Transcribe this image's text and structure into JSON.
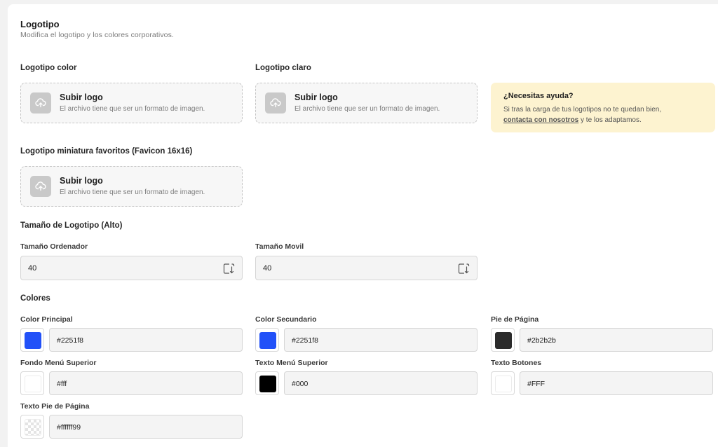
{
  "header": {
    "title": "Logotipo",
    "subtitle": "Modifica el logotipo y los colores corporativos."
  },
  "logos": {
    "color": {
      "label": "Logotipo color",
      "upload_title": "Subir logo",
      "upload_hint": "El archivo tiene que ser un formato de imagen."
    },
    "light": {
      "label": "Logotipo claro",
      "upload_title": "Subir logo",
      "upload_hint": "El archivo tiene que ser un formato de imagen."
    },
    "favicon": {
      "label": "Logotipo miniatura favoritos (Favicon 16x16)",
      "upload_title": "Subir logo",
      "upload_hint": "El archivo tiene que ser un formato de imagen."
    }
  },
  "help": {
    "title": "¿Necesitas ayuda?",
    "line1": "Si tras la carga de tus logotipos no te quedan bien,",
    "link": "contacta con nosotros",
    "line2_rest": " y te los adaptamos."
  },
  "size": {
    "section": "Tamaño de Logotipo (Alto)",
    "desktop_label": "Tamaño Ordenador",
    "desktop_value": "40",
    "mobile_label": "Tamaño Movil",
    "mobile_value": "40"
  },
  "colors": {
    "section": "Colores",
    "items": [
      {
        "label": "Color Principal",
        "value": "#2251f8",
        "swatch": "#2251f8"
      },
      {
        "label": "Color Secundario",
        "value": "#2251f8",
        "swatch": "#2251f8"
      },
      {
        "label": "Pie de Página",
        "value": "#2b2b2b",
        "swatch": "#2b2b2b"
      },
      {
        "label": "Fondo Menú Superior",
        "value": "#fff",
        "swatch": "#ffffff"
      },
      {
        "label": "Texto Menú Superior",
        "value": "#000",
        "swatch": "#000000"
      },
      {
        "label": "Texto Botones",
        "value": "#FFF",
        "swatch": "#ffffff"
      },
      {
        "label": "Texto Pie de Página",
        "value": "#ffffff99",
        "swatch": "transparent"
      }
    ]
  },
  "icons": {
    "upload": "cloud-upload-icon",
    "stepper": "resize-stepper-icon"
  }
}
